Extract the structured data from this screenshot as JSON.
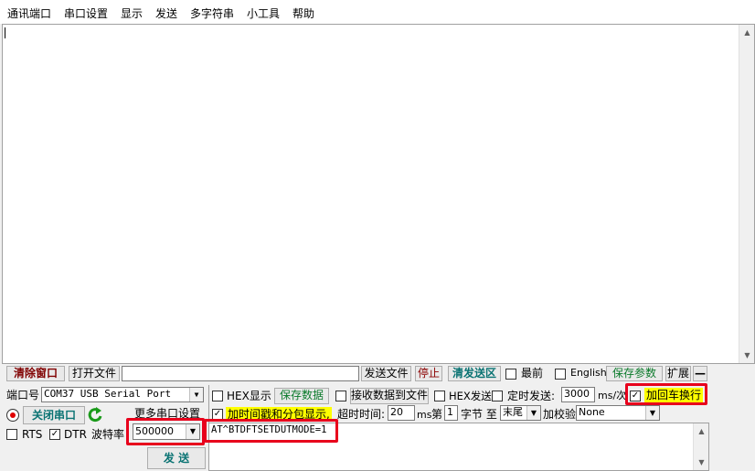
{
  "menu": [
    "通讯端口",
    "串口设置",
    "显示",
    "发送",
    "多字符串",
    "小工具",
    "帮助"
  ],
  "toolbar": {
    "clear_window": "清除窗口",
    "open_file": "打开文件",
    "send_file": "发送文件",
    "stop": "停止",
    "clear_send": "清发送区",
    "topmost": "最前",
    "english": "English",
    "save_params": "保存参数",
    "expand": "扩展",
    "collapse": "—"
  },
  "port": {
    "label": "端口号",
    "value": "COM37 USB Serial Port",
    "more_settings": "更多串口设置",
    "close_button": "关闭串口",
    "rts": "RTS",
    "dtr": "DTR",
    "baud_label": "波特率",
    "baud_value": "500000",
    "send_button": "发  送"
  },
  "options": {
    "hex_display": "HEX显示",
    "save_data": "保存数据",
    "recv_to_file": "接收数据到文件",
    "hex_send": "HEX发送",
    "timed_send": "定时发送:",
    "interval": "3000",
    "interval_unit": "ms/次",
    "add_crlf": "加回车换行",
    "timestamp": "加时间戳和分包显示,",
    "timeout_label": "超时时间:",
    "timeout_value": "20",
    "timeout_unit": "ms",
    "byte_prefix": "第",
    "byte_index": "1",
    "byte_mid": "字节 至",
    "byte_end": "末尾",
    "checksum_label": "加校验",
    "checksum_value": "None"
  },
  "send_text": "AT^BTDFTSETDUTMODE=1",
  "colors": {
    "highlight": "#ffff00",
    "annotation": "#e8001c"
  }
}
